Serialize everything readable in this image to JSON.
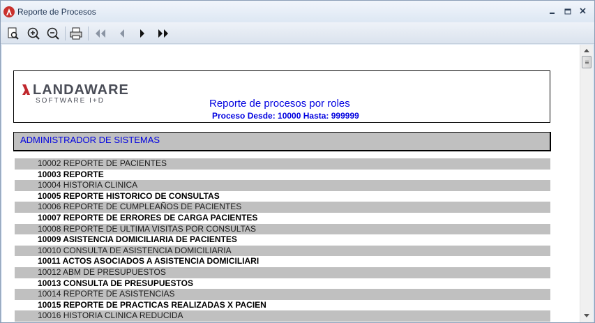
{
  "window": {
    "title": "Reporte de Procesos",
    "app_icon": "landaware-app-icon",
    "controls": [
      "minimize-icon",
      "maximize-icon",
      "close-icon"
    ]
  },
  "toolbar": {
    "buttons": [
      "page-setup-icon",
      "zoom-in-icon",
      "zoom-out-icon",
      "print-icon",
      "first-page-icon",
      "previous-page-icon",
      "next-page-icon",
      "last-page-icon"
    ]
  },
  "report": {
    "logo_name": "LANDAWARE",
    "logo_tagline": "SOFTWARE I+D",
    "title": "Reporte de procesos por roles",
    "subtitle": "Proceso Desde: 10000 Hasta: 999999",
    "role": "ADMINISTRADOR DE SISTEMAS",
    "rows": [
      "10002 REPORTE DE PACIENTES",
      "10003 REPORTE",
      "10004 HISTORIA CLINICA",
      "10005 REPORTE HISTORICO DE CONSULTAS",
      "10006 REPORTE DE CUMPLEAÑOS DE PACIENTES",
      "10007 REPORTE DE ERRORES DE CARGA PACIENTES",
      "10008 REPORTE DE ULTIMA VISITAS POR CONSULTAS",
      "10009 ASISTENCIA DOMICILIARIA DE PACIENTES",
      "10010 CONSULTA DE ASISTENCIA DOMICILIARIA",
      "10011 ACTOS ASOCIADOS A ASISTENCIA DOMICILIARI",
      "10012 ABM DE PRESUPUESTOS",
      "10013 CONSULTA DE PRESUPUESTOS",
      "10014 REPORTE DE ASISTENCIAS",
      "10015 REPORTE DE PRACTICAS REALIZADAS X PACIEN",
      "10016 HISTORIA CLINICA REDUCIDA"
    ]
  },
  "colors": {
    "accent_blue": "#0000e0",
    "row_shade": "#c0c0c0",
    "logo_red": "#c0272d"
  }
}
